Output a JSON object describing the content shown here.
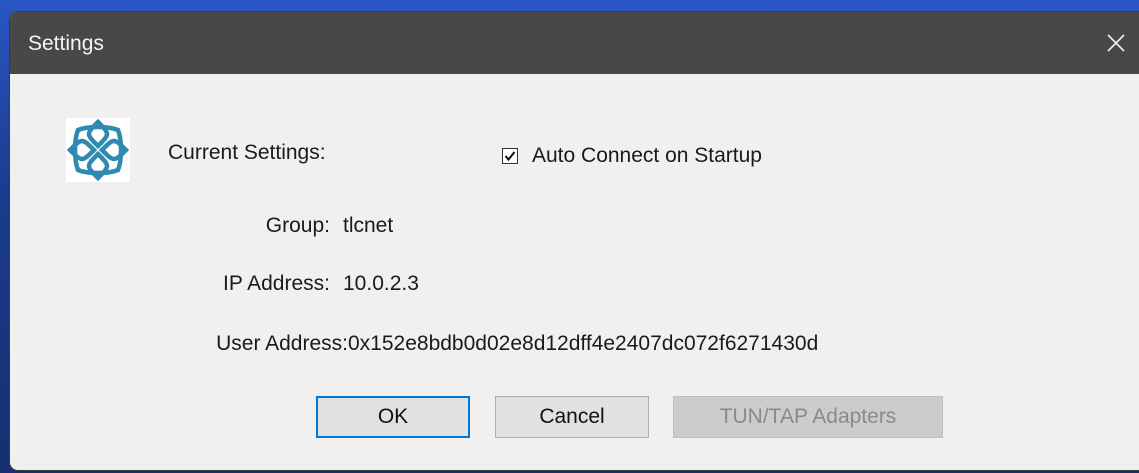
{
  "window": {
    "title": "Settings",
    "close_icon": "close-icon"
  },
  "app_icon": "vpn-logo-icon",
  "settings": {
    "heading": "Current Settings:",
    "auto_connect": {
      "label": "Auto Connect on Startup",
      "checked": true
    },
    "group_label": "Group:",
    "group_value": "tlcnet",
    "ip_label": "IP Address:",
    "ip_value": "10.0.2.3",
    "user_label": "User Address:",
    "user_value": "0x152e8bdb0d02e8d12dff4e2407dc072f6271430d"
  },
  "buttons": {
    "ok": "OK",
    "cancel": "Cancel",
    "tun_tap": "TUN/TAP Adapters",
    "tun_tap_enabled": false
  },
  "colors": {
    "titlebar": "#484848",
    "dialog_bg": "#f0f0f0",
    "logo_accent": "#2e8ab0",
    "focus_border": "#0078d7"
  }
}
